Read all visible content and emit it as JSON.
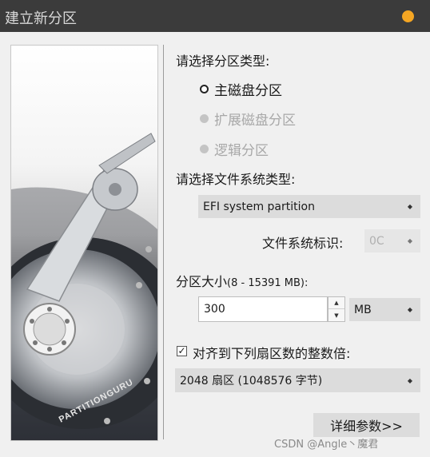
{
  "window": {
    "title": "建立新分区",
    "status_color": "#f5a623"
  },
  "image_panel": {
    "brand": "PARTITIONGURU"
  },
  "partition_type": {
    "label": "请选择分区类型:",
    "options": [
      {
        "label": "主磁盘分区",
        "selected": true,
        "enabled": true
      },
      {
        "label": "扩展磁盘分区",
        "selected": false,
        "enabled": false
      },
      {
        "label": "逻辑分区",
        "selected": false,
        "enabled": false
      }
    ]
  },
  "filesystem": {
    "label": "请选择文件系统类型:",
    "value": "EFI system partition",
    "id_label": "文件系统标识:",
    "id_value": "0C"
  },
  "size": {
    "label_main": "分区大小",
    "label_range": "(8 - 15391 MB):",
    "value": "300",
    "unit": "MB"
  },
  "alignment": {
    "checkbox_label": "对齐到下列扇区数的整数倍:",
    "checked": true,
    "check_mark": "✓",
    "value": "2048 扇区 (1048576 字节)"
  },
  "buttons": {
    "details": "详细参数>>"
  },
  "watermark": "CSDN @Angle丶魔君"
}
